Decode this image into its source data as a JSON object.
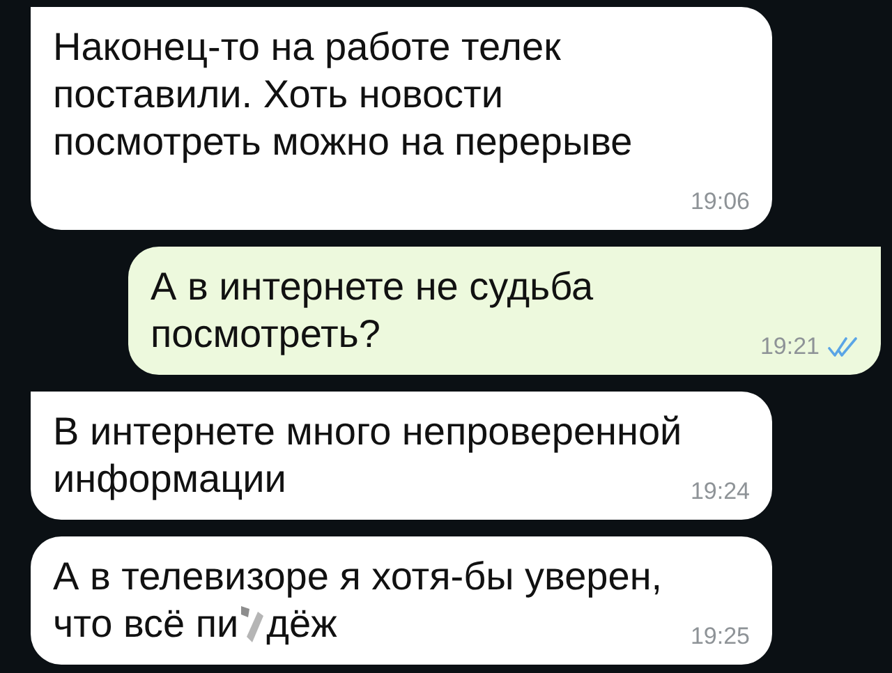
{
  "messages": [
    {
      "kind": "incoming",
      "tail": true,
      "lines": [
        "Наконец-то на работе телек",
        "поставили. Хоть новости",
        "посмотреть можно на перерыве"
      ],
      "time": "19:06"
    },
    {
      "kind": "outgoing",
      "tail": true,
      "lines": [
        "А в интернете не судьба",
        "посмотреть?"
      ],
      "time": "19:21",
      "read": true
    },
    {
      "kind": "incoming",
      "tail": true,
      "lines": [
        "В интернете много непроверенной",
        "информации"
      ],
      "time": "19:24"
    },
    {
      "kind": "incoming",
      "tail": false,
      "lines": [
        "А в телевизоре я хотя-бы уверен,",
        "что всё пи"
      ],
      "after_censor": "дёж",
      "time": "19:25"
    }
  ]
}
